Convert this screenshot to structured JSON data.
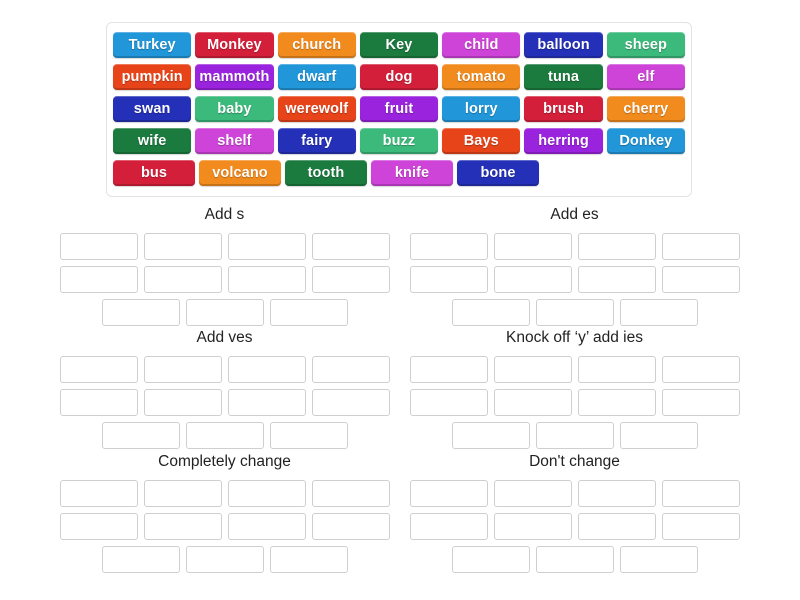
{
  "activity": {
    "type": "group-sort",
    "tile_text_color": "#ffffff",
    "slot_border_color": "#cfcfcf",
    "bank_border_color": "#e3e3e3"
  },
  "word_bank": {
    "rows": [
      [
        {
          "label": "Turkey",
          "color": "#2196d8"
        },
        {
          "label": "Monkey",
          "color": "#d41f3a"
        },
        {
          "label": "church",
          "color": "#f28b1e"
        },
        {
          "label": "Key",
          "color": "#1b7a3e"
        },
        {
          "label": "child",
          "color": "#cf44d8"
        },
        {
          "label": "balloon",
          "color": "#2430b8"
        },
        {
          "label": "sheep",
          "color": "#3cba7c"
        }
      ],
      [
        {
          "label": "pumpkin",
          "color": "#e8441a"
        },
        {
          "label": "mammoth",
          "color": "#9a23dd"
        },
        {
          "label": "dwarf",
          "color": "#2196d8"
        },
        {
          "label": "dog",
          "color": "#d41f3a"
        },
        {
          "label": "tomato",
          "color": "#f28b1e"
        },
        {
          "label": "tuna",
          "color": "#1b7a3e"
        },
        {
          "label": "elf",
          "color": "#cf44d8"
        }
      ],
      [
        {
          "label": "swan",
          "color": "#2430b8"
        },
        {
          "label": "baby",
          "color": "#3cba7c"
        },
        {
          "label": "werewolf",
          "color": "#e8441a"
        },
        {
          "label": "fruit",
          "color": "#9a23dd"
        },
        {
          "label": "lorry",
          "color": "#2196d8"
        },
        {
          "label": "brush",
          "color": "#d41f3a"
        },
        {
          "label": "cherry",
          "color": "#f28b1e"
        }
      ],
      [
        {
          "label": "wife",
          "color": "#1b7a3e"
        },
        {
          "label": "shelf",
          "color": "#cf44d8"
        },
        {
          "label": "fairy",
          "color": "#2430b8"
        },
        {
          "label": "buzz",
          "color": "#3cba7c"
        },
        {
          "label": "Bays",
          "color": "#e8441a"
        },
        {
          "label": "herring",
          "color": "#9a23dd"
        },
        {
          "label": "Donkey",
          "color": "#2196d8"
        }
      ],
      [
        {
          "label": "bus",
          "color": "#d41f3a"
        },
        {
          "label": "volcano",
          "color": "#f28b1e"
        },
        {
          "label": "tooth",
          "color": "#1b7a3e"
        },
        {
          "label": "knife",
          "color": "#cf44d8"
        },
        {
          "label": "bone",
          "color": "#2430b8"
        }
      ]
    ]
  },
  "categories": [
    {
      "title": "Add s",
      "slot_rows": [
        4,
        4,
        3
      ],
      "values": []
    },
    {
      "title": "Add es",
      "slot_rows": [
        4,
        4,
        3
      ],
      "values": []
    },
    {
      "title": "Add ves",
      "slot_rows": [
        4,
        4,
        3
      ],
      "values": []
    },
    {
      "title": "Knock off ‘y’ add ies",
      "slot_rows": [
        4,
        4,
        3
      ],
      "values": []
    },
    {
      "title": "Completely change",
      "slot_rows": [
        4,
        4,
        3
      ],
      "values": []
    },
    {
      "title": "Don't change",
      "slot_rows": [
        4,
        4,
        3
      ],
      "values": []
    }
  ]
}
